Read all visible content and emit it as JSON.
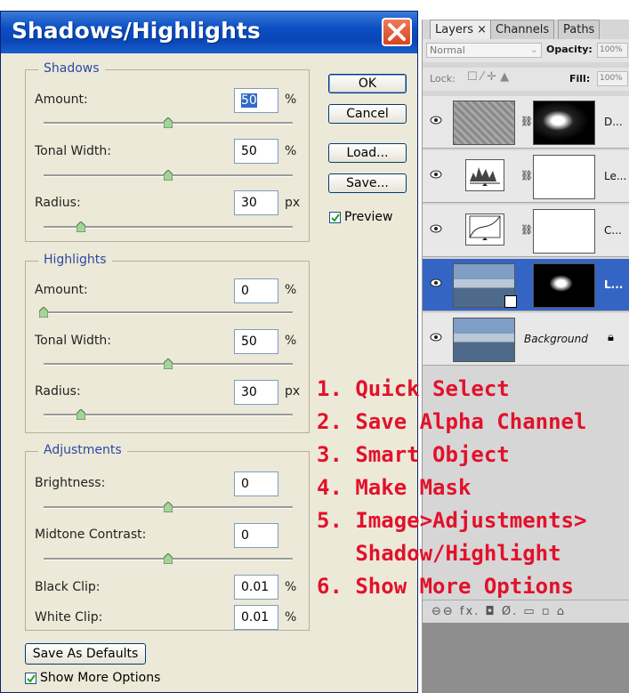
{
  "dialog": {
    "title": "Shadows/Highlights",
    "shadows": {
      "legend": "Shadows",
      "amount": {
        "label": "Amount:",
        "value": "50",
        "unit": "%",
        "level": 0.5
      },
      "tonal_width": {
        "label": "Tonal Width:",
        "value": "50",
        "unit": "%",
        "level": 0.5
      },
      "radius": {
        "label": "Radius:",
        "value": "30",
        "unit": "px",
        "level": 0.15
      }
    },
    "highlights": {
      "legend": "Highlights",
      "amount": {
        "label": "Amount:",
        "value": "0",
        "unit": "%",
        "level": 0.0
      },
      "tonal_width": {
        "label": "Tonal Width:",
        "value": "50",
        "unit": "%",
        "level": 0.5
      },
      "radius": {
        "label": "Radius:",
        "value": "30",
        "unit": "px",
        "level": 0.15
      }
    },
    "adjustments": {
      "legend": "Adjustments",
      "brightness": {
        "label": "Brightness:",
        "value": "0",
        "level": 0.5
      },
      "midtone_contrast": {
        "label": "Midtone Contrast:",
        "value": "0",
        "level": 0.5
      },
      "black_clip": {
        "label": "Black Clip:",
        "value": "0.01",
        "unit": "%"
      },
      "white_clip": {
        "label": "White Clip:",
        "value": "0.01",
        "unit": "%"
      }
    },
    "buttons": {
      "ok": "OK",
      "cancel": "Cancel",
      "load": "Load...",
      "save": "Save...",
      "save_defaults": "Save As Defaults"
    },
    "preview": {
      "label": "Preview",
      "checked": true
    },
    "show_more": {
      "label": "Show More Options",
      "checked": true
    }
  },
  "layers_panel": {
    "tabs": [
      "Layers ×",
      "Channels",
      "Paths"
    ],
    "blend_mode": "Normal",
    "opacity_label": "Opacity:",
    "opacity_value": "100%",
    "lock_label": "Lock:",
    "fill_label": "Fill:",
    "fill_value": "100%",
    "layers": [
      {
        "name": "D..."
      },
      {
        "name": "Le..."
      },
      {
        "name": "C..."
      },
      {
        "name": "L..."
      },
      {
        "name": "Background"
      }
    ],
    "footer_icons": "⊖⊖ fx. ◘ Ø. ▭ ▫ ⌂"
  },
  "annotation": {
    "steps": [
      "1. Quick Select",
      "2. Save Alpha Channel",
      "3. Smart Object",
      "4. Make Mask",
      "5. Image>Adjustments>",
      "   Shadow/Highlight",
      "6. Show More Options"
    ]
  },
  "colors": {
    "annotation": "#e2112a",
    "title_bar": "#0b4ec3",
    "selected_layer": "#3565c4"
  }
}
